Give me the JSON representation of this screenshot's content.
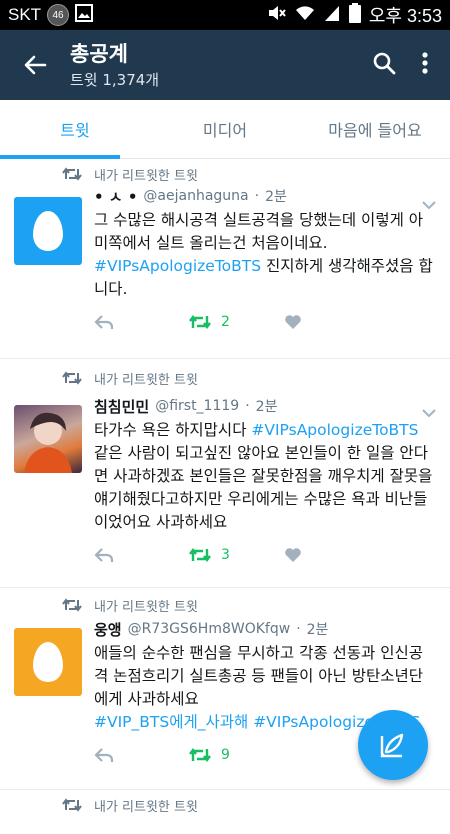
{
  "status_bar": {
    "carrier": "SKT",
    "network_badge": "46",
    "time": "오후 3:53"
  },
  "app_bar": {
    "title": "총공계",
    "subtitle": "트윗 1,374개"
  },
  "tabs": [
    {
      "label": "트윗",
      "active": true
    },
    {
      "label": "미디어",
      "active": false
    },
    {
      "label": "마음에 들어요",
      "active": false
    }
  ],
  "colors": {
    "accent": "#1da1f2",
    "appbar": "#20394f",
    "retweet_green": "#17bf63"
  },
  "tweets": [
    {
      "retweet_label": "내가 리트윗한 트윗",
      "name": "• ㅅ •",
      "handle": "@aejanhaguna",
      "time": "2분",
      "text_plain": "그 수많은 해시공격 실트공격을 당했는데 이렇게 아미쪽에서 실트 올리는건 처음이네요.",
      "hashtag": "#VIPsApologizeToBTS",
      "text_after": " 진지하게 생각해주셨음 합니다.",
      "retweets": "2"
    },
    {
      "retweet_label": "내가 리트윗한 트윗",
      "name": "침침민민",
      "handle": "@first_1119",
      "time": "2분",
      "text_before": "타가수 욕은 하지맙시다 ",
      "hashtag": "#VIPsApologizeToBTS",
      "text_after": " 같은 사람이 되고싶진 않아요 본인들이 한 일을 안다면 사과하겠죠 본인들은 잘못한점을 깨우치게 잘못을 얘기해줬다고하지만 우리에게는 수많은 욕과 비난들이었어요 사과하세요",
      "retweets": "3"
    },
    {
      "retweet_label": "내가 리트윗한 트윗",
      "name": "웅앵",
      "handle": "@R73GS6Hm8WOKfqw",
      "time": "2분",
      "text_plain": "애들의 순수한 팬심을 무시하고 각종 선동과 인신공격 논점흐리기 실트총공 등 팬들이 아닌 방탄소년단에게 사과하세요",
      "hashtag1": "#VIP_BTS에게_사과해",
      "hashtag2": "#VIPsApologizeToBTS",
      "retweets": "9"
    },
    {
      "retweet_label": "내가 리트윗한 트윗"
    }
  ]
}
